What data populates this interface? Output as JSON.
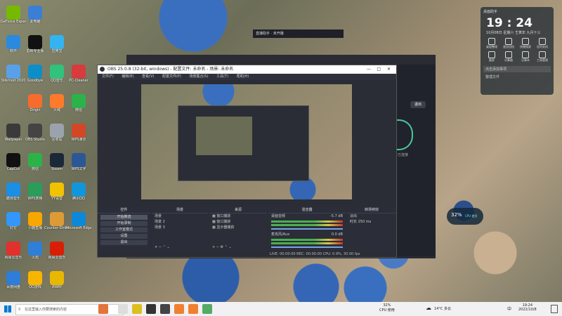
{
  "desktop_icons": [
    {
      "label": "GeForce Experience",
      "color": "#76b900",
      "col": 0,
      "row": 0
    },
    {
      "label": "此电脑",
      "color": "#3b7ed6",
      "col": 1,
      "row": 0
    },
    {
      "label": "软件",
      "color": "#2a8ae0",
      "col": 0,
      "row": 1
    },
    {
      "label": "剪映专业版",
      "color": "#111111",
      "col": 1,
      "row": 1
    },
    {
      "label": "应用宝",
      "color": "#34b3f1",
      "col": 2,
      "row": 1
    },
    {
      "label": "Stikmod 2020",
      "color": "#5aa0e8",
      "col": 0,
      "row": 2
    },
    {
      "label": "Goodbye",
      "color": "#0e8ec9",
      "col": 1,
      "row": 2
    },
    {
      "label": "QQ音乐",
      "color": "#31c27c",
      "col": 2,
      "row": 2
    },
    {
      "label": "PC-Cleaner",
      "color": "#d83b3b",
      "col": 3,
      "row": 2
    },
    {
      "label": "Origin",
      "color": "#f56c2d",
      "col": 1,
      "row": 3
    },
    {
      "label": "火绒",
      "color": "#ff7a2b",
      "col": 2,
      "row": 3
    },
    {
      "label": "微信",
      "color": "#2bb34a",
      "col": 3,
      "row": 3
    },
    {
      "label": "Wallpaper",
      "color": "#3a3a3a",
      "col": 0,
      "row": 4
    },
    {
      "label": "OBS Studio",
      "color": "#444444",
      "col": 1,
      "row": 4
    },
    {
      "label": "回收站",
      "color": "#9aa3ad",
      "col": 2,
      "row": 4
    },
    {
      "label": "WPS演示",
      "color": "#d24726",
      "col": 3,
      "row": 4
    },
    {
      "label": "CapCut",
      "color": "#111111",
      "col": 0,
      "row": 5
    },
    {
      "label": "微信",
      "color": "#2bb34a",
      "col": 1,
      "row": 5
    },
    {
      "label": "Steam",
      "color": "#1b2838",
      "col": 2,
      "row": 5
    },
    {
      "label": "WPS文字",
      "color": "#2b5797",
      "col": 3,
      "row": 5
    },
    {
      "label": "酷狗音乐",
      "color": "#1a8fe3",
      "col": 0,
      "row": 6
    },
    {
      "label": "WPS表格",
      "color": "#2a9d5a",
      "col": 1,
      "row": 6
    },
    {
      "label": "YY语音",
      "color": "#f2c200",
      "col": 2,
      "row": 6
    },
    {
      "label": "腾讯QQ",
      "color": "#1296db",
      "col": 3,
      "row": 6
    },
    {
      "label": "钉钉",
      "color": "#3296fa",
      "col": 0,
      "row": 7
    },
    {
      "label": "小鹿直播",
      "color": "#f7a700",
      "col": 1,
      "row": 7
    },
    {
      "label": "Counter-Strike Global",
      "color": "#de9b35",
      "col": 2,
      "row": 7
    },
    {
      "label": "Microsoft Edge",
      "color": "#0c88d8",
      "col": 3,
      "row": 7
    },
    {
      "label": "网易云音乐",
      "color": "#e0312c",
      "col": 0,
      "row": 8
    },
    {
      "label": "火焰",
      "color": "#2f7fd8",
      "col": 1,
      "row": 8
    },
    {
      "label": "网易云音乐",
      "color": "#d81e06",
      "col": 2,
      "row": 8
    },
    {
      "label": "百度网盘",
      "color": "#2e7dd8",
      "col": 0,
      "row": 9
    },
    {
      "label": "QQ游戏",
      "color": "#f8b500",
      "col": 1,
      "row": 9
    },
    {
      "label": "AWAY",
      "color": "#e8b800",
      "col": 2,
      "row": 9
    }
  ],
  "bg_window": {
    "title": "直播助手 · 未开播"
  },
  "obs": {
    "title": "OBS 25.0.8 (32-bit, windows) - 配置文件: 未命名 - 场景: 未命名",
    "menu": [
      "文件(F)",
      "编辑(E)",
      "查看(V)",
      "配置文件(P)",
      "场景集合(S)",
      "工具(T)",
      "帮助(H)"
    ],
    "controls": {
      "header": "控件",
      "buttons": [
        "开始推流",
        "开始录制",
        "工作室模式",
        "设置",
        "退出"
      ]
    },
    "scenes": {
      "header": "场景",
      "items": [
        "场景",
        "场景 2",
        "场景 3"
      ]
    },
    "sources": {
      "header": "来源",
      "items": [
        "窗口捕获",
        "窗口捕获",
        "显示器捕获"
      ]
    },
    "mixer": {
      "header": "混音器",
      "channels": [
        {
          "name": "桌面音频",
          "db": "-5.7 dB"
        },
        {
          "name": "麦克风/Aux",
          "db": "0.0 dB"
        }
      ]
    },
    "transitions": {
      "header": "转场特效",
      "type": "淡出",
      "duration_label": "时长",
      "duration": "250 ms"
    },
    "status": "LIVE: 00:00:00   REC: 00:00:00   CPU: 0.9%, 30.00 fps"
  },
  "side_panel": {
    "button": "退出",
    "status": "已连接"
  },
  "widget": {
    "header": "桌面助手",
    "time": "19 : 24",
    "date": "10月08日",
    "weekday": "星期六",
    "lunar": "壬寅年 九月十三",
    "shortcuts": [
      "桌面整理",
      "速览回档",
      "快捷搜索",
      "定时关机",
      "截屏",
      "计算器",
      "记事本",
      "工具管理"
    ],
    "search": "点击添加事项",
    "note": "整理文件"
  },
  "cpu_meter": {
    "percent": "32%",
    "label": "CPU 使用"
  },
  "taskbar": {
    "search_placeholder": "在这里输入你要搜索的内容",
    "weather": "14°C 多云",
    "time": "19:24",
    "date": "2022/10/8",
    "cpu": "32%",
    "cpu_label": "CPU 使用",
    "lang": "中"
  }
}
